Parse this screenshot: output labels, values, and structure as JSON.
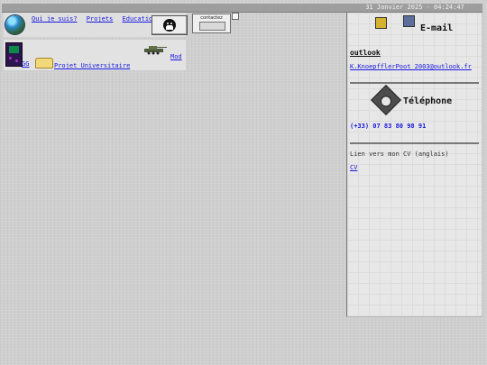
{
  "header": {
    "datetime": "31 Janvier 2025 - 04:24:47"
  },
  "navigation": {
    "links": [
      "Qui je suis?",
      "Projets",
      "Education"
    ],
    "contacts_label": "contactez"
  },
  "projects": {
    "gameboy_label": "GG",
    "university_project": "Projet Universitaire",
    "mod_label": "Mod"
  },
  "contact": {
    "email_title": "E-mail",
    "provider_label": "outlook",
    "email_value": "K.KnoepfflerPoot_2003@outlook.fr",
    "phone_title": "Téléphone",
    "phone_value": "(+33) 07 83 80 98 91",
    "cv_text": "Lien vers mon CV (anglais)",
    "cv_link": "CV"
  },
  "colors": {
    "link": "#1a1ae0",
    "background": "#cfcfcf",
    "panel": "#e7e7e7"
  },
  "icons": [
    "globe-icon",
    "github-icon",
    "contacts-icon",
    "gameboy-icon",
    "book-icon",
    "tank-icon",
    "phone-icon",
    "email-icons"
  ]
}
